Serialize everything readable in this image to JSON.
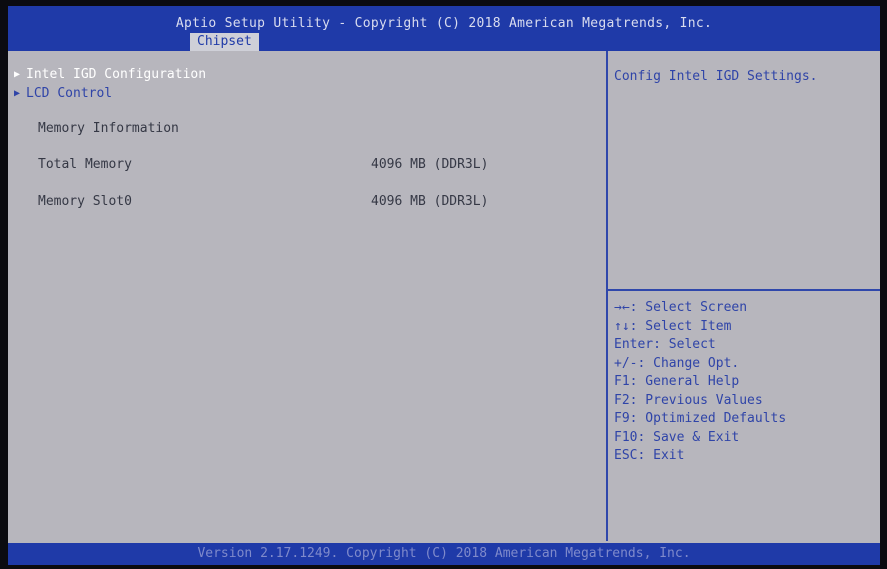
{
  "header": {
    "title": "Aptio Setup Utility - Copyright (C) 2018 American Megatrends, Inc.",
    "active_tab": "Chipset"
  },
  "menu": {
    "items": [
      {
        "label": "Intel IGD Configuration",
        "icon": "triangle-right-icon"
      },
      {
        "label": "LCD Control",
        "icon": "triangle-right-icon"
      }
    ]
  },
  "memory": {
    "section_label": "Memory Information",
    "rows": [
      {
        "label": "Total Memory",
        "value": "4096 MB (DDR3L)"
      },
      {
        "label": "Memory Slot0",
        "value": "4096 MB (DDR3L)"
      }
    ]
  },
  "help": {
    "description": "Config Intel IGD Settings.",
    "keys": [
      "→←: Select Screen",
      "↑↓: Select Item",
      "Enter: Select",
      "+/-: Change Opt.",
      "F1: General Help",
      "F2: Previous Values",
      "F9: Optimized Defaults",
      "F10: Save & Exit",
      "ESC: Exit"
    ]
  },
  "footer": {
    "text": "Version 2.17.1249. Copyright (C) 2018 American Megatrends, Inc."
  },
  "colors": {
    "header_bg": "#1f3aa8",
    "panel_bg": "#b7b6bd",
    "accent_text": "#2f44a8",
    "selected_text": "#ffffff"
  }
}
